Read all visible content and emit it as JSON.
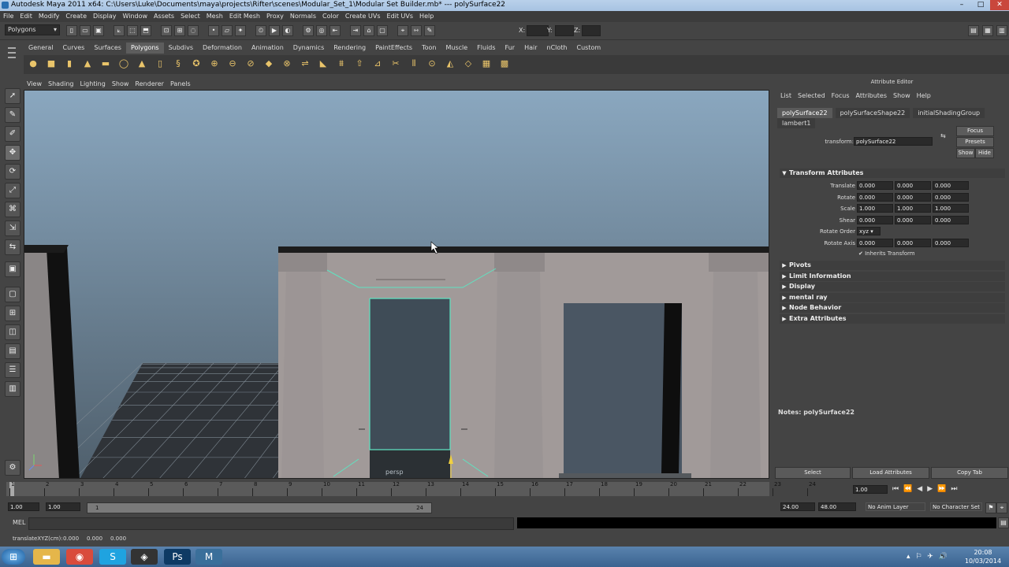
{
  "window": {
    "title": "Autodesk Maya 2011 x64: C:\\Users\\Luke\\Documents\\maya\\projects\\Rifter\\scenes\\Modular_Set_1\\Modular Set Builder.mb*   ---   polySurface22",
    "minimize": "–",
    "maximize": "□",
    "close": "✕"
  },
  "menubar": [
    "File",
    "Edit",
    "Modify",
    "Create",
    "Display",
    "Window",
    "Assets",
    "Select",
    "Mesh",
    "Edit Mesh",
    "Proxy",
    "Normals",
    "Color",
    "Create UVs",
    "Edit UVs",
    "Help"
  ],
  "statusline": {
    "mode": "Polygons",
    "x_label": "X:",
    "y_label": "Y:",
    "z_label": "Z:"
  },
  "shelf": {
    "tabs": [
      "General",
      "Curves",
      "Surfaces",
      "Polygons",
      "Subdivs",
      "Deformation",
      "Animation",
      "Dynamics",
      "Rendering",
      "PaintEffects",
      "Toon",
      "Muscle",
      "Fluids",
      "Fur",
      "Hair",
      "nCloth",
      "Custom"
    ],
    "active": "Polygons",
    "icons": [
      "sphere-icon",
      "cube-icon",
      "cylinder-icon",
      "cone-icon",
      "plane-icon",
      "torus-icon",
      "pyramid-icon",
      "pipe-icon",
      "helix-icon",
      "soccer-ball-icon",
      "combine-icon",
      "separate-icon",
      "extract-icon",
      "smooth-icon",
      "booleans-icon",
      "mirror-icon",
      "bevel-icon",
      "bridge-icon",
      "extrude-icon",
      "append-icon",
      "split-icon",
      "insert-loop-icon",
      "merge-icon",
      "triangulate-icon",
      "quadrangulate-icon",
      "uv-editor-icon",
      "checker-icon"
    ]
  },
  "viewport": {
    "menu": [
      "View",
      "Shading",
      "Lighting",
      "Show",
      "Renderer",
      "Panels"
    ],
    "camera_label": "persp",
    "sky_top": "#8aa7bf",
    "sky_bottom": "#4f5f6c",
    "ground": "#2f3338"
  },
  "attribute_editor": {
    "title": "Attribute Editor",
    "menu": [
      "List",
      "Selected",
      "Focus",
      "Attributes",
      "Show",
      "Help"
    ],
    "tabs": [
      "polySurface22",
      "polySurfaceShape22",
      "initialShadingGroup",
      "lambert1"
    ],
    "active_tab": "polySurface22",
    "focus_btn": "Focus",
    "presets_btn": "Presets",
    "show_btn": "Show",
    "hide_btn": "Hide",
    "transform_label": "transform:",
    "transform_value": "polySurface22",
    "transform_section": "Transform Attributes",
    "attrs": [
      {
        "label": "Translate",
        "values": [
          "0.000",
          "0.000",
          "0.000"
        ]
      },
      {
        "label": "Rotate",
        "values": [
          "0.000",
          "0.000",
          "0.000"
        ]
      },
      {
        "label": "Scale",
        "values": [
          "1.000",
          "1.000",
          "1.000"
        ]
      },
      {
        "label": "Shear",
        "values": [
          "0.000",
          "0.000",
          "0.000"
        ]
      }
    ],
    "rotate_order_label": "Rotate Order",
    "rotate_order_value": "xyz",
    "rotate_axis_label": "Rotate Axis",
    "rotate_axis_values": [
      "0.000",
      "0.000",
      "0.000"
    ],
    "inherits_transform": "Inherits Transform",
    "collapsed_sections": [
      "Pivots",
      "Limit Information",
      "Display",
      "mental ray",
      "Node Behavior",
      "Extra Attributes"
    ],
    "notes_label": "Notes:  polySurface22",
    "bottom_buttons": [
      "Select",
      "Load Attributes",
      "Copy Tab"
    ]
  },
  "timeline": {
    "ticks": [
      "1",
      "2",
      "3",
      "4",
      "5",
      "6",
      "7",
      "8",
      "9",
      "10",
      "11",
      "12",
      "13",
      "14",
      "15",
      "16",
      "17",
      "18",
      "19",
      "20",
      "21",
      "22",
      "23",
      "24"
    ],
    "current_frame": "1.00",
    "range_start": "1.00",
    "range_start_inner": "1.00",
    "range_mid_start": "1",
    "range_mid_end": "24",
    "range_end": "24.00",
    "range_end_outer": "48.00",
    "anim_layer": "No Anim Layer",
    "char_set": "No Character Set"
  },
  "cmdline": {
    "label": "MEL"
  },
  "helpline": {
    "label": "translateXYZ(cm):",
    "values": [
      "0.000",
      "0.000",
      "0.000"
    ]
  },
  "taskbar": {
    "time": "20:08",
    "date": "10/03/2014",
    "apps": [
      "windows-start-icon",
      "explorer-icon",
      "chrome-icon",
      "skype-icon",
      "unity-icon",
      "photoshop-icon",
      "maya-icon"
    ]
  }
}
